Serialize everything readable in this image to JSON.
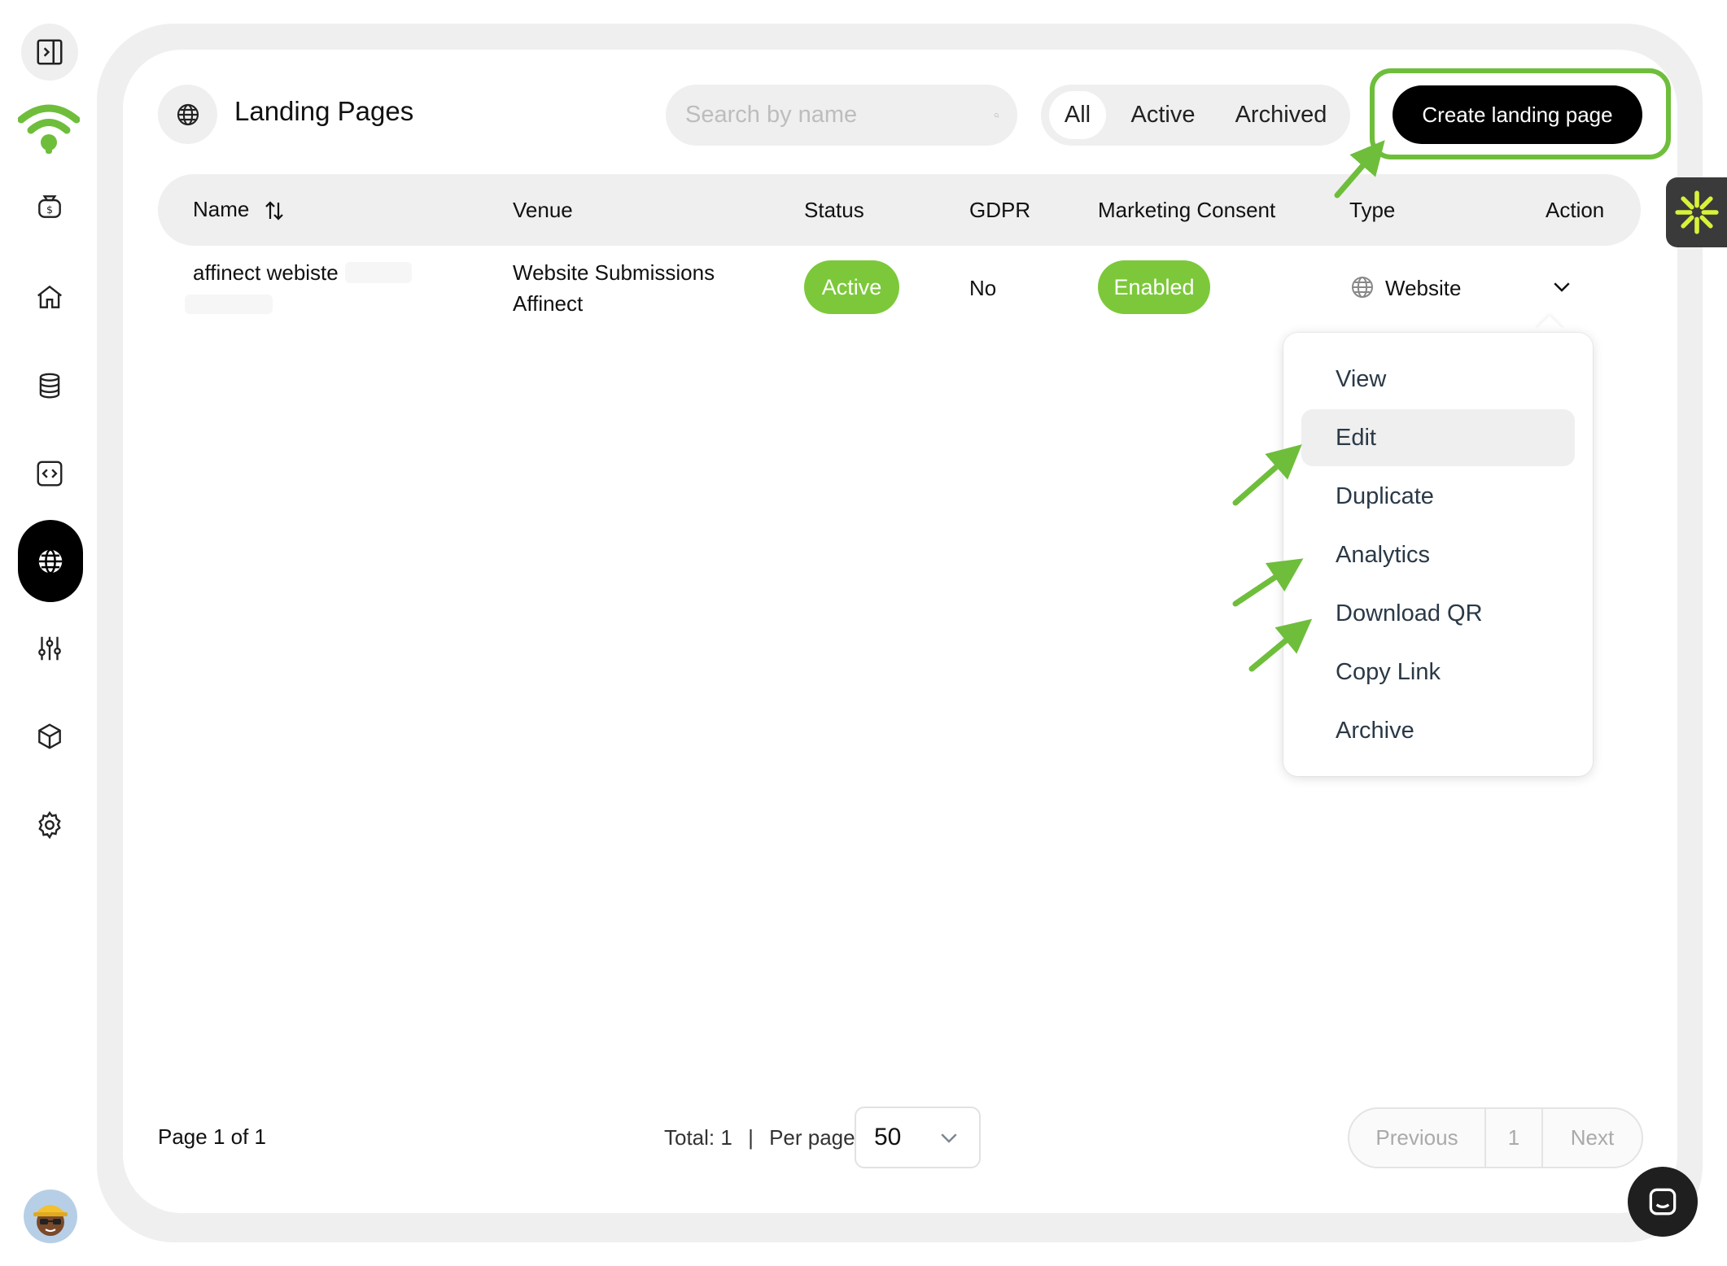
{
  "header": {
    "title": "Landing Pages",
    "search_placeholder": "Search by name",
    "filters": [
      "All",
      "Active",
      "Archived"
    ],
    "create_label": "Create landing page"
  },
  "table": {
    "columns": [
      "Name",
      "Venue",
      "Status",
      "GDPR",
      "Marketing Consent",
      "Type",
      "Action"
    ],
    "rows": [
      {
        "name": "affinect webiste",
        "venue_line1": "Website Submissions",
        "venue_line2": "Affinect",
        "status": "Active",
        "gdpr": "No",
        "marketing": "Enabled",
        "type": "Website"
      }
    ]
  },
  "action_menu": {
    "items": [
      "View",
      "Edit",
      "Duplicate",
      "Analytics",
      "Download QR",
      "Copy Link",
      "Archive"
    ],
    "hovered": "Edit"
  },
  "footer": {
    "page_info": "Page 1 of 1",
    "total": "Total: 1",
    "per_page_label": "Per page:",
    "per_page_value": "50",
    "prev_label": "Previous",
    "current_page": "1",
    "next_label": "Next"
  },
  "colors": {
    "accent_green": "#7cc83a",
    "highlight_green": "#6ebe3b",
    "primary_button": "#000000",
    "panel_gray": "#efefef"
  },
  "icons": [
    "sidebar-toggle-icon",
    "brand-wifi-logo",
    "money-bag-icon",
    "home-icon",
    "database-icon",
    "code-icon",
    "globe-icon",
    "sliders-icon",
    "cube-icon",
    "gear-icon",
    "search-icon",
    "sort-icon",
    "chevron-down-icon",
    "asterisk-icon",
    "chat-icon"
  ]
}
